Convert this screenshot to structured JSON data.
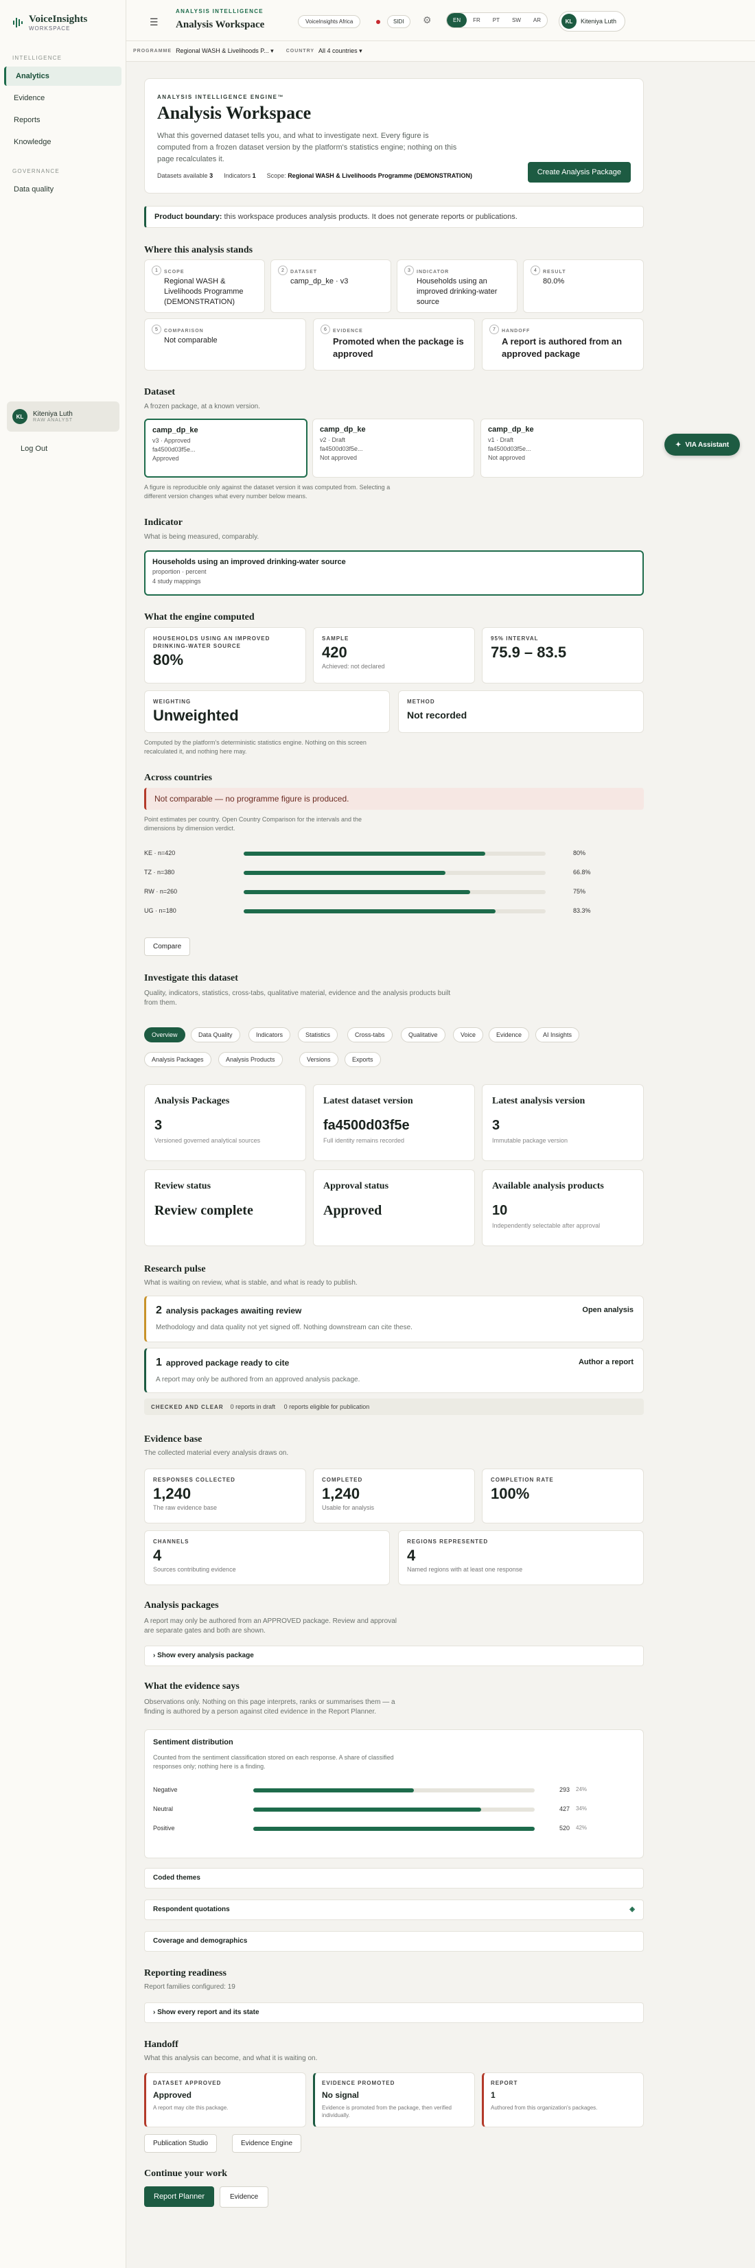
{
  "app": {
    "name": "VoiceInsights",
    "sub": "WORKSPACE"
  },
  "sidebar": {
    "sections": [
      {
        "title": "INTELLIGENCE",
        "items": [
          {
            "label": "Analytics",
            "active": true
          },
          {
            "label": "Evidence"
          },
          {
            "label": "Reports"
          },
          {
            "label": "Knowledge"
          }
        ]
      },
      {
        "title": "GOVERNANCE",
        "items": [
          {
            "label": "Data quality"
          }
        ]
      }
    ],
    "user": {
      "initials": "KL",
      "name": "Kiteniya Luth",
      "role": "RAW ANALYST"
    },
    "logout": "Log Out"
  },
  "topbar": {
    "eyebrow": "ANALYSIS INTELLIGENCE",
    "title": "Analysis Workspace",
    "tenant": "VoiceInsights Africa",
    "sidx": "SIDI",
    "languages": [
      "EN",
      "FR",
      "PT",
      "SW",
      "AR"
    ],
    "active_language": "EN",
    "user": {
      "initials": "KL",
      "name": "Kiteniya Luth"
    }
  },
  "filters": {
    "programme_label": "PROGRAMME",
    "programme": "Regional WASH & Livelihoods P...",
    "country_label": "COUNTRY",
    "country": "All 4 countries"
  },
  "hero": {
    "eyebrow": "ANALYSIS INTELLIGENCE ENGINE™",
    "title": "Analysis Workspace",
    "desc": "What this governed dataset tells you, and what to investigate next. Every figure is computed from a frozen dataset version by the platform's statistics engine; nothing on this page recalculates it.",
    "datasets_label": "Datasets available",
    "datasets": "3",
    "indicators_label": "Indicators",
    "indicators": "1",
    "scope_label": "Scope:",
    "scope": "Regional WASH & Livelihoods Programme (DEMONSTRATION)",
    "cta": "Create Analysis Package"
  },
  "boundary": {
    "strong": "Product boundary:",
    "text": " this workspace produces analysis products. It does not generate reports or publications."
  },
  "stands": {
    "title": "Where this analysis stands",
    "steps": [
      {
        "n": "1",
        "label": "SCOPE",
        "value": "Regional WASH & Livelihoods Programme (DEMONSTRATION)"
      },
      {
        "n": "2",
        "label": "DATASET",
        "value": "camp_dp_ke · v3"
      },
      {
        "n": "3",
        "label": "INDICATOR",
        "value": "Households using an improved drinking-water source"
      },
      {
        "n": "4",
        "label": "RESULT",
        "value": "80.0%"
      },
      {
        "n": "5",
        "label": "COMPARISON",
        "value": "Not comparable"
      },
      {
        "n": "6",
        "label": "EVIDENCE",
        "value": "Promoted when the package is approved"
      },
      {
        "n": "7",
        "label": "HANDOFF",
        "value": "A report is authored from an approved package"
      }
    ]
  },
  "dataset": {
    "title": "Dataset",
    "sub": "A frozen package, at a known version.",
    "cards": [
      {
        "name": "camp_dp_ke",
        "ver": "v3 · Approved",
        "hash": "fa4500d03f5e...",
        "status": "Approved"
      },
      {
        "name": "camp_dp_ke",
        "ver": "v2 · Draft",
        "hash": "fa4500d03f5e...",
        "status": "Not approved"
      },
      {
        "name": "camp_dp_ke",
        "ver": "v1 · Draft",
        "hash": "fa4500d03f5e...",
        "status": "Not approved"
      }
    ],
    "note": "A figure is reproducible only against the dataset version it was computed from. Selecting a different version changes what every number below means."
  },
  "indicator": {
    "title": "Indicator",
    "sub": "What is being measured, comparably.",
    "name": "Households using an improved drinking-water source",
    "type": "proportion · percent",
    "mappings": "4 study mappings"
  },
  "engine": {
    "title": "What the engine computed",
    "stats": [
      {
        "label": "HOUSEHOLDS USING AN IMPROVED DRINKING-WATER SOURCE",
        "value": "80%",
        "sub": ""
      },
      {
        "label": "SAMPLE",
        "value": "420",
        "sub": "Achieved: not declared"
      },
      {
        "label": "95% INTERVAL",
        "value": "75.9 – 83.5",
        "sub": ""
      },
      {
        "label": "WEIGHTING",
        "value": "Unweighted",
        "sub": ""
      },
      {
        "label": "METHOD",
        "value": "Not recorded",
        "sub": ""
      }
    ],
    "note": "Computed by the platform's deterministic statistics engine. Nothing on this screen recalculated it, and nothing here may."
  },
  "countries": {
    "title": "Across countries",
    "warning": "Not comparable — no programme figure is produced.",
    "note": "Point estimates per country. Open Country Comparison for the intervals and the dimensions by dimension verdict.",
    "rows": [
      {
        "label": "KE · n=420",
        "value": 80,
        "pct": "80%"
      },
      {
        "label": "TZ · n=380",
        "value": 66.8,
        "pct": "66.8%"
      },
      {
        "label": "RW · n=260",
        "value": 75,
        "pct": "75%"
      },
      {
        "label": "UG · n=180",
        "value": 83.3,
        "pct": "83.3%"
      }
    ],
    "compare": "Compare"
  },
  "investigate": {
    "title": "Investigate this dataset",
    "sub": "Quality, indicators, statistics, cross-tabs, qualitative material, evidence and the analysis products built from them.",
    "tabs": [
      "Overview",
      "Data Quality",
      "Indicators",
      "Statistics",
      "Cross-tabs",
      "Qualitative",
      "Voice",
      "Evidence",
      "AI Insights",
      "Analysis Packages",
      "Analysis Products",
      "Versions",
      "Exports"
    ],
    "kpis": [
      {
        "title": "Analysis Packages",
        "value": "3",
        "sub": "Versioned governed analytical sources"
      },
      {
        "title": "Latest dataset version",
        "value": "fa4500d03f5e",
        "sub": "Full identity remains recorded"
      },
      {
        "title": "Latest analysis version",
        "value": "3",
        "sub": "Immutable package version"
      },
      {
        "title": "Review status",
        "value": "Review complete",
        "sub": ""
      },
      {
        "title": "Approval status",
        "value": "Approved",
        "sub": ""
      },
      {
        "title": "Available analysis products",
        "value": "10",
        "sub": "Independently selectable after approval"
      }
    ]
  },
  "pulse": {
    "title": "Research pulse",
    "sub": "What is waiting on review, what is stable, and what is ready to publish.",
    "items": [
      {
        "n": "2",
        "title": "analysis packages awaiting review",
        "text": "Methodology and data quality not yet signed off. Nothing downstream can cite these.",
        "link": "Open analysis"
      },
      {
        "n": "1",
        "title": "approved package ready to cite",
        "text": "A report may only be authored from an approved analysis package.",
        "link": "Author a report"
      }
    ],
    "clear_label": "CHECKED AND CLEAR",
    "clear_a": "0 reports in draft",
    "clear_b": "0 reports eligible for publication"
  },
  "evidence": {
    "title": "Evidence base",
    "sub": "The collected material every analysis draws on.",
    "stats": [
      {
        "label": "RESPONSES COLLECTED",
        "value": "1,240",
        "sub": "The raw evidence base"
      },
      {
        "label": "COMPLETED",
        "value": "1,240",
        "sub": "Usable for analysis"
      },
      {
        "label": "COMPLETION RATE",
        "value": "100%",
        "sub": ""
      },
      {
        "label": "CHANNELS",
        "value": "4",
        "sub": "Sources contributing evidence"
      },
      {
        "label": "REGIONS REPRESENTED",
        "value": "4",
        "sub": "Named regions with at least one response"
      }
    ]
  },
  "packages": {
    "title": "Analysis packages",
    "sub": "A report may only be authored from an APPROVED package. Review and approval are separate gates and both are shown.",
    "toggle": "Show every analysis package"
  },
  "says": {
    "title": "What the evidence says",
    "sub": "Observations only. Nothing on this page interprets, ranks or summarises them — a finding is authored by a person against cited evidence in the Report Planner.",
    "sentiment": {
      "title": "Sentiment distribution",
      "text": "Counted from the sentiment classification stored on each response. A share of classified responses only; nothing here is a finding.",
      "rows": [
        {
          "label": "Negative",
          "count": "293",
          "pct": "24%",
          "value": 24
        },
        {
          "label": "Neutral",
          "count": "427",
          "pct": "34%",
          "value": 34
        },
        {
          "label": "Positive",
          "count": "520",
          "pct": "42%",
          "value": 42
        }
      ]
    },
    "sections": [
      "Coded themes",
      "Respondent quotations",
      "Coverage and demographics"
    ]
  },
  "readiness": {
    "title": "Reporting readiness",
    "sub": "Report families configured: 19",
    "toggle": "Show every report and its state"
  },
  "handoff": {
    "title": "Handoff",
    "sub": "What this analysis can become, and what it is waiting on.",
    "cards": [
      {
        "label": "DATASET APPROVED",
        "value": "Approved",
        "sub": "A report may cite this package."
      },
      {
        "label": "EVIDENCE PROMOTED",
        "value": "No signal",
        "sub": "Evidence is promoted from the package, then verified individually."
      },
      {
        "label": "REPORT",
        "value": "1",
        "sub": "Authored from this organization's packages."
      }
    ],
    "links": [
      "Publication Studio",
      "Evidence Engine"
    ]
  },
  "continue": {
    "title": "Continue your work",
    "primary": "Report Planner",
    "secondary": "Evidence"
  },
  "via": "VIA Assistant",
  "colors": {
    "accent": "#1d5b42",
    "danger": "#b33a2a"
  }
}
